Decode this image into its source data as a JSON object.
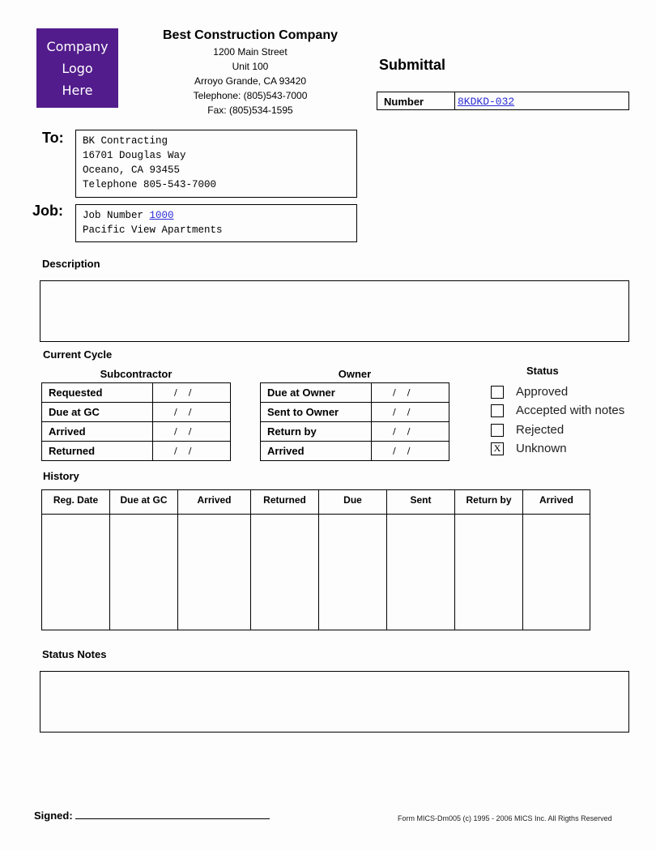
{
  "logo": {
    "lines": [
      "Company",
      "Logo",
      "Here"
    ],
    "color": "#521c8c"
  },
  "company": {
    "name": "Best Construction Company",
    "address_lines": [
      "1200 Main Street",
      "Unit 100",
      "Arroyo Grande, CA 93420",
      "Telephone: (805)543-7000",
      "Fax: (805)534-1595"
    ]
  },
  "submittal": {
    "title": "Submittal",
    "number_label": "Number",
    "number_value": "8KDKD-032"
  },
  "to": {
    "label": "To:",
    "lines": [
      "BK Contracting",
      "16701 Douglas Way",
      "Oceano, CA 93455",
      "Telephone 805-543-7000"
    ]
  },
  "job": {
    "label": "Job:",
    "number_label": "Job Number",
    "number_value": "1000",
    "name": "Pacific View Apartments"
  },
  "description": {
    "label": "Description",
    "value": ""
  },
  "current_cycle": {
    "label": "Current Cycle",
    "subcontractor": {
      "title": "Subcontractor",
      "rows": [
        {
          "label": "Requested",
          "value": "/    /"
        },
        {
          "label": "Due at GC",
          "value": "/    /"
        },
        {
          "label": "Arrived",
          "value": "/    /"
        },
        {
          "label": "Returned",
          "value": "/    /"
        }
      ]
    },
    "owner": {
      "title": "Owner",
      "rows": [
        {
          "label": "Due at Owner",
          "value": "/    /"
        },
        {
          "label": "Sent to Owner",
          "value": "/    /"
        },
        {
          "label": "Return by",
          "value": "/    /"
        },
        {
          "label": "Arrived",
          "value": "/    /"
        }
      ]
    }
  },
  "status": {
    "title": "Status",
    "options": [
      {
        "label": "Approved",
        "mark": ""
      },
      {
        "label": "Accepted with notes",
        "mark": ""
      },
      {
        "label": "Rejected",
        "mark": ""
      },
      {
        "label": "Unknown",
        "mark": "X"
      }
    ]
  },
  "history": {
    "label": "History",
    "columns": [
      "Reg. Date",
      "Due at GC",
      "Arrived",
      "Returned",
      "Due",
      "Sent",
      "Return by",
      "Arrived"
    ]
  },
  "status_notes": {
    "label": "Status Notes",
    "value": ""
  },
  "signed": {
    "label": "Signed:"
  },
  "footer": "Form MICS-Dm005 (c) 1995 - 2006 MICS Inc. All Rigths Reserved"
}
